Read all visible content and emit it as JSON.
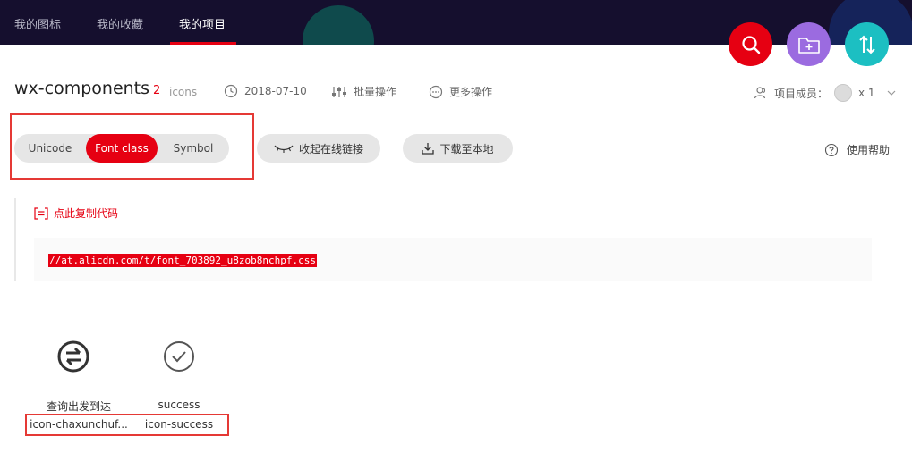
{
  "nav": {
    "tabs": [
      {
        "label": "我的图标"
      },
      {
        "label": "我的收藏"
      },
      {
        "label": "我的项目"
      }
    ],
    "active_color": "#e60012"
  },
  "fabs": {
    "search_color": "#e60012",
    "add_folder_color": "#9b6be0",
    "sort_color": "#1cbfc2"
  },
  "project": {
    "name": "wx-components",
    "icon_count": "2",
    "icon_count_label": "icons",
    "date": "2018-07-10",
    "batch_label": "批量操作",
    "more_label": "更多操作",
    "members_label": "项目成员：",
    "members_count": "x 1"
  },
  "mode_tabs": {
    "items": [
      {
        "label": "Unicode"
      },
      {
        "label": "Font class"
      },
      {
        "label": "Symbol"
      }
    ],
    "active_index": 1
  },
  "actions": {
    "collapse_link": "收起在线链接",
    "download": "下载至本地",
    "help": "使用帮助"
  },
  "code": {
    "copy_label": "点此复制代码",
    "url": "//at.alicdn.com/t/font_703892_u8zob8nchpf.css"
  },
  "icons": [
    {
      "title": "查询出发到达",
      "code": "icon-chaxunchuf...",
      "glyph": "swap-circle-icon"
    },
    {
      "title": "success",
      "code": "icon-success",
      "glyph": "check-circle-icon"
    }
  ]
}
